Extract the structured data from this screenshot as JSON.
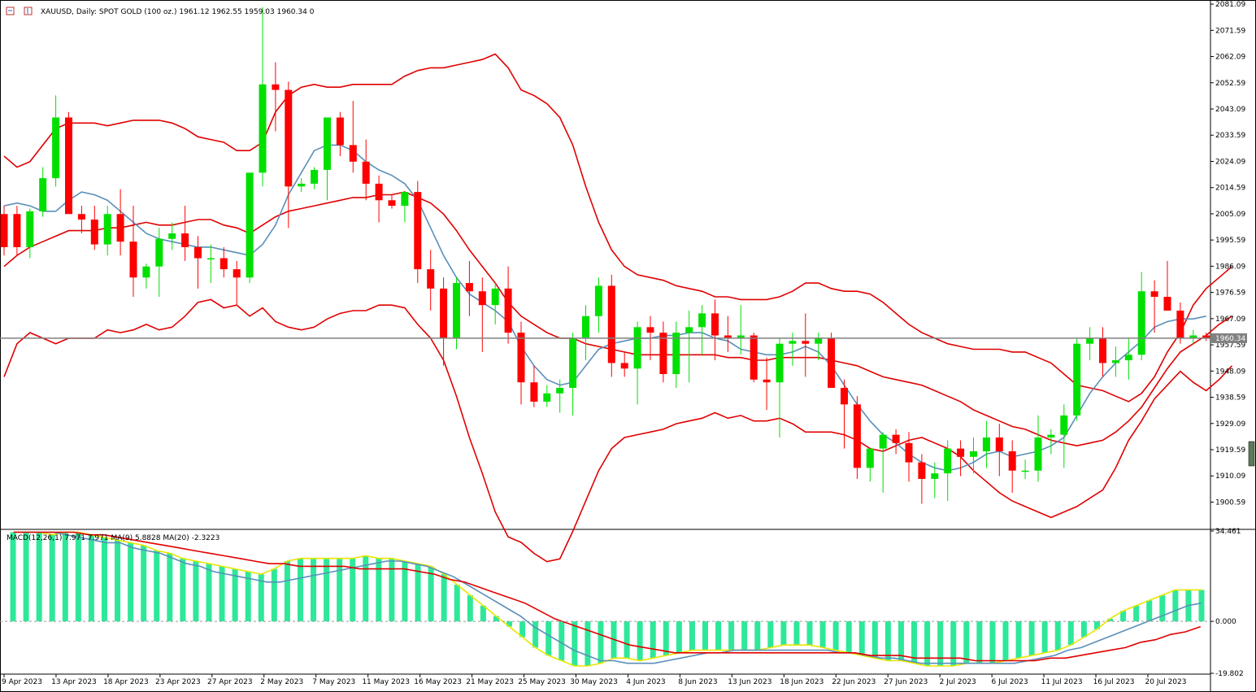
{
  "header": {
    "symbol": "XAUUSD",
    "timeframe": "Daily",
    "description": "SPOT GOLD (100 oz.)",
    "ohlc": "1961.12 1962.55 1959.03 1960.34",
    "volume": "0"
  },
  "indicator_header": "MACD(12,26,1) 7.971 7.971 MA(9) 5.8828 MA(20) -2.3223",
  "current_price_label": "1960.34",
  "colors": {
    "bull": "#00e000",
    "bear": "#ff0000",
    "bollinger": "#e00000",
    "sma": "#5a8fba",
    "macd_hist": "#2ee89a",
    "macd_line": "#e6e600",
    "macd_ma9": "#5a8fba",
    "macd_ma20": "#e00000"
  },
  "chart_data": [
    {
      "type": "candlestick",
      "title": "XAUUSD, Daily: SPOT GOLD (100 oz.)",
      "ylim": [
        1891.0,
        2082.0
      ],
      "y_ticks": [
        "2081.09",
        "2071.59",
        "2062.09",
        "2052.59",
        "2043.09",
        "2033.59",
        "2024.09",
        "2014.59",
        "2005.09",
        "1995.59",
        "1986.09",
        "1976.59",
        "1967.09",
        "1957.59",
        "1948.09",
        "1938.59",
        "1929.09",
        "1919.59",
        "1910.09",
        "1900.59"
      ],
      "x_tick_labels": [
        "9 Apr 2023",
        "13 Apr 2023",
        "18 Apr 2023",
        "23 Apr 2023",
        "27 Apr 2023",
        "2 May 2023",
        "7 May 2023",
        "11 May 2023",
        "16 May 2023",
        "21 May 2023",
        "25 May 2023",
        "30 May 2023",
        "4 Jun 2023",
        "8 Jun 2023",
        "13 Jun 2023",
        "18 Jun 2023",
        "22 Jun 2023",
        "27 Jun 2023",
        "2 Jul 2023",
        "6 Jul 2023",
        "11 Jul 2023",
        "16 Jul 2023",
        "20 Jul 2023"
      ],
      "candles": [
        [
          2005,
          2008,
          1990,
          1993
        ],
        [
          2005,
          2008,
          1990,
          1993
        ],
        [
          1993,
          2007,
          1989,
          2006
        ],
        [
          2006,
          2022,
          2004,
          2018
        ],
        [
          2018,
          2048,
          2015,
          2040
        ],
        [
          2040,
          2042,
          2016,
          2005
        ],
        [
          2005,
          2008,
          1998,
          2003
        ],
        [
          2003,
          2008,
          1992,
          1994
        ],
        [
          1994,
          2008,
          1990,
          2005
        ],
        [
          2005,
          2014,
          1990,
          1995
        ],
        [
          1995,
          2008,
          1975,
          1982
        ],
        [
          1982,
          1987,
          1978,
          1986
        ],
        [
          1986,
          2000,
          1975,
          1996
        ],
        [
          1996,
          2002,
          1992,
          1998
        ],
        [
          1998,
          2008,
          1988,
          1993
        ],
        [
          1993,
          1997,
          1978,
          1989
        ],
        [
          1989,
          1994,
          1980,
          1989
        ],
        [
          1989,
          1993,
          1982,
          1985
        ],
        [
          1985,
          1988,
          1972,
          1982
        ],
        [
          1982,
          2014,
          1980,
          2020
        ],
        [
          2020,
          2080,
          2015,
          2052
        ],
        [
          2052,
          2060,
          2035,
          2050
        ],
        [
          2050,
          2053,
          2000,
          2015
        ],
        [
          2015,
          2018,
          2013,
          2016
        ],
        [
          2016,
          2022,
          2014,
          2021
        ],
        [
          2021,
          2040,
          2010,
          2040
        ],
        [
          2040,
          2042,
          2026,
          2030
        ],
        [
          2030,
          2046,
          2020,
          2024
        ],
        [
          2024,
          2032,
          2010,
          2016
        ],
        [
          2016,
          2019,
          2002,
          2010
        ],
        [
          2010,
          2012,
          2007,
          2008
        ],
        [
          2008,
          2012,
          2002,
          2013
        ],
        [
          2013,
          2017,
          1980,
          1985
        ],
        [
          1985,
          1992,
          1970,
          1978
        ],
        [
          1978,
          1982,
          1950,
          1960
        ],
        [
          1960,
          1982,
          1956,
          1980
        ],
        [
          1980,
          1988,
          1968,
          1977
        ],
        [
          1977,
          1982,
          1955,
          1972
        ],
        [
          1972,
          1980,
          1965,
          1978
        ],
        [
          1978,
          1986,
          1958,
          1962
        ],
        [
          1962,
          1966,
          1936,
          1944
        ],
        [
          1944,
          1950,
          1935,
          1937
        ],
        [
          1937,
          1943,
          1935,
          1940
        ],
        [
          1940,
          1945,
          1933,
          1942
        ],
        [
          1942,
          1962,
          1932,
          1960
        ],
        [
          1960,
          1972,
          1952,
          1968
        ],
        [
          1968,
          1982,
          1962,
          1979
        ],
        [
          1979,
          1983,
          1946,
          1951
        ],
        [
          1951,
          1955,
          1946,
          1949
        ],
        [
          1949,
          1966,
          1936,
          1964
        ],
        [
          1964,
          1968,
          1952,
          1962
        ],
        [
          1962,
          1966,
          1944,
          1947
        ],
        [
          1947,
          1966,
          1942,
          1962
        ],
        [
          1962,
          1970,
          1944,
          1964
        ],
        [
          1964,
          1972,
          1954,
          1969
        ],
        [
          1969,
          1974,
          1952,
          1961
        ],
        [
          1961,
          1968,
          1955,
          1960
        ],
        [
          1960,
          1972,
          1954,
          1961
        ],
        [
          1961,
          1962,
          1944,
          1945
        ],
        [
          1945,
          1953,
          1934,
          1944
        ],
        [
          1944,
          1960,
          1924,
          1958
        ],
        [
          1958,
          1962,
          1950,
          1959
        ],
        [
          1959,
          1969,
          1946,
          1958
        ],
        [
          1958,
          1962,
          1952,
          1960
        ],
        [
          1960,
          1962,
          1942,
          1942
        ],
        [
          1942,
          1945,
          1920,
          1936
        ],
        [
          1936,
          1939,
          1909,
          1913
        ],
        [
          1913,
          1920,
          1908,
          1920
        ],
        [
          1920,
          1926,
          1904,
          1925
        ],
        [
          1925,
          1927,
          1918,
          1922
        ],
        [
          1922,
          1926,
          1908,
          1915
        ],
        [
          1915,
          1918,
          1900,
          1909
        ],
        [
          1909,
          1915,
          1902,
          1911
        ],
        [
          1911,
          1923,
          1901,
          1920
        ],
        [
          1920,
          1923,
          1910,
          1917
        ],
        [
          1917,
          1924,
          1911,
          1919
        ],
        [
          1919,
          1930,
          1913,
          1924
        ],
        [
          1924,
          1929,
          1910,
          1919
        ],
        [
          1919,
          1923,
          1904,
          1912
        ],
        [
          1912,
          1916,
          1909,
          1912
        ],
        [
          1912,
          1932,
          1908,
          1924
        ],
        [
          1924,
          1927,
          1918,
          1925
        ],
        [
          1925,
          1936,
          1913,
          1932
        ],
        [
          1932,
          1960,
          1930,
          1958
        ],
        [
          1958,
          1964,
          1952,
          1960
        ],
        [
          1960,
          1964,
          1946,
          1951
        ],
        [
          1951,
          1957,
          1946,
          1952
        ],
        [
          1952,
          1960,
          1945,
          1954
        ],
        [
          1954,
          1984,
          1952,
          1977
        ],
        [
          1977,
          1981,
          1962,
          1975
        ],
        [
          1975,
          1988,
          1970,
          1970
        ],
        [
          1970,
          1973,
          1958,
          1960
        ],
        [
          1960,
          1963,
          1958,
          1961
        ],
        [
          1961,
          1962,
          1959,
          1960
        ]
      ],
      "sma": [
        2008,
        2009,
        2008,
        2006,
        2006,
        2010,
        2013,
        2012,
        2010,
        2006,
        2002,
        1998,
        1996,
        1995,
        1994,
        1993,
        1993,
        1992,
        1991,
        1990,
        1994,
        2001,
        2012,
        2020,
        2028,
        2030,
        2030,
        2028,
        2024,
        2021,
        2019,
        2016,
        2010,
        2000,
        1990,
        1982,
        1976,
        1973,
        1970,
        1966,
        1957,
        1950,
        1945,
        1943,
        1944,
        1950,
        1956,
        1958,
        1959,
        1960,
        1960,
        1961,
        1961,
        1962,
        1962,
        1960,
        1959,
        1956,
        1955,
        1954,
        1954,
        1955,
        1957,
        1955,
        1950,
        1943,
        1936,
        1930,
        1925,
        1922,
        1918,
        1915,
        1913,
        1912,
        1913,
        1915,
        1918,
        1919,
        1917,
        1918,
        1919,
        1921,
        1924,
        1932,
        1940,
        1946,
        1951,
        1955,
        1959,
        1964,
        1966,
        1967,
        1967,
        1968
      ],
      "bollinger_upper": [
        2026,
        2022,
        2024,
        2030,
        2036,
        2038,
        2038,
        2038,
        2037,
        2038,
        2039,
        2039,
        2039,
        2038,
        2036,
        2033,
        2032,
        2031,
        2028,
        2028,
        2031,
        2042,
        2048,
        2051,
        2052,
        2051,
        2051,
        2052,
        2052,
        2052,
        2052,
        2055,
        2057,
        2058,
        2058,
        2059,
        2060,
        2061,
        2063,
        2058,
        2050,
        2048,
        2045,
        2040,
        2030,
        2015,
        2002,
        1992,
        1986,
        1983,
        1982,
        1981,
        1979,
        1978,
        1977,
        1975,
        1975,
        1974,
        1974,
        1974,
        1975,
        1977,
        1980,
        1980,
        1978,
        1977,
        1977,
        1976,
        1973,
        1969,
        1965,
        1962,
        1960,
        1958,
        1957,
        1956,
        1956,
        1956,
        1955,
        1955,
        1953,
        1951,
        1947,
        1943,
        1942,
        1941,
        1939,
        1937,
        1940,
        1946,
        1955,
        1962,
        1972,
        1978,
        1982,
        1986
      ],
      "bollinger_mid": [
        1986,
        1990,
        1993,
        1995,
        1997,
        1999,
        1999,
        1999,
        2000,
        2000,
        2001,
        2002,
        2001,
        2001,
        2002,
        2003,
        2003,
        2001,
        2000,
        1998,
        2001,
        2004,
        2006,
        2007,
        2008,
        2009,
        2010,
        2011,
        2011,
        2012,
        2012,
        2013,
        2011,
        2009,
        2005,
        1999,
        1992,
        1986,
        1980,
        1973,
        1968,
        1965,
        1962,
        1960,
        1960,
        1958,
        1957,
        1956,
        1955,
        1954,
        1954,
        1954,
        1954,
        1954,
        1954,
        1954,
        1953,
        1953,
        1952,
        1952,
        1953,
        1953,
        1953,
        1953,
        1952,
        1951,
        1950,
        1948,
        1946,
        1945,
        1944,
        1943,
        1941,
        1939,
        1937,
        1934,
        1932,
        1930,
        1928,
        1927,
        1925,
        1923,
        1922,
        1921,
        1922,
        1923,
        1926,
        1930,
        1935,
        1942,
        1949,
        1955,
        1958,
        1961,
        1965,
        1968
      ],
      "bollinger_lower": [
        1946,
        1958,
        1962,
        1960,
        1958,
        1960,
        1960,
        1960,
        1963,
        1962,
        1963,
        1965,
        1963,
        1964,
        1968,
        1973,
        1974,
        1971,
        1972,
        1968,
        1971,
        1966,
        1964,
        1963,
        1964,
        1967,
        1969,
        1970,
        1970,
        1972,
        1972,
        1971,
        1965,
        1960,
        1952,
        1939,
        1924,
        1911,
        1897,
        1888,
        1886,
        1882,
        1879,
        1880,
        1890,
        1901,
        1912,
        1920,
        1924,
        1925,
        1926,
        1927,
        1929,
        1930,
        1931,
        1933,
        1931,
        1932,
        1930,
        1930,
        1931,
        1929,
        1926,
        1926,
        1926,
        1925,
        1923,
        1920,
        1919,
        1921,
        1923,
        1924,
        1922,
        1920,
        1917,
        1912,
        1908,
        1904,
        1901,
        1899,
        1897,
        1895,
        1897,
        1899,
        1902,
        1905,
        1913,
        1923,
        1930,
        1938,
        1943,
        1948,
        1944,
        1941,
        1945,
        1950
      ]
    },
    {
      "type": "bar",
      "title": "MACD(12,26,1) 7.971 7.971 MA(9) 5.8828 MA(20) -2.3223",
      "ylim": [
        -19.802,
        34.461
      ],
      "y_ticks": [
        "34.461",
        "0.000",
        "-19.802"
      ],
      "series": [
        {
          "name": "MACD(12,26,1)",
          "values": [
            34,
            34,
            34,
            33,
            34,
            34,
            33,
            32,
            31,
            30,
            29,
            27,
            26,
            24,
            23,
            22,
            21,
            20,
            19,
            18,
            20,
            23,
            24,
            24,
            24,
            24,
            24,
            25,
            24,
            24,
            23,
            22,
            21,
            18,
            14,
            10,
            6,
            2,
            -2,
            -6,
            -10,
            -13,
            -15,
            -17,
            -17,
            -16,
            -14,
            -14,
            -15,
            -14,
            -13,
            -12,
            -11,
            -11,
            -11,
            -11,
            -11,
            -11,
            -10,
            -9,
            -9,
            -9,
            -10,
            -11,
            -12,
            -13,
            -14,
            -15,
            -15,
            -16,
            -17,
            -17,
            -17,
            -16,
            -16,
            -16,
            -15,
            -14,
            -13,
            -12,
            -11,
            -9,
            -6,
            -3,
            1,
            4,
            6,
            8,
            10,
            12,
            12,
            12
          ]
        },
        {
          "name": "MA(9)",
          "values": [
            34,
            34,
            34,
            34,
            33,
            32,
            31,
            30,
            30,
            28,
            27,
            26,
            24,
            22,
            21,
            19,
            18,
            17,
            16,
            15,
            15,
            16,
            17,
            18,
            19,
            20,
            21,
            22,
            23,
            23,
            22,
            21,
            19,
            17,
            14,
            11,
            8,
            5,
            2,
            -2,
            -5,
            -8,
            -11,
            -13,
            -15,
            -15,
            -16,
            -16,
            -16,
            -15,
            -14,
            -13,
            -12,
            -12,
            -11,
            -11,
            -11,
            -11,
            -11,
            -11,
            -11,
            -11,
            -12,
            -12,
            -13,
            -14,
            -14,
            -15,
            -16,
            -16,
            -16,
            -16,
            -16,
            -16,
            -16,
            -16,
            -15,
            -14,
            -13,
            -11,
            -10,
            -8,
            -6,
            -4,
            -2,
            0,
            2,
            4,
            6,
            7
          ]
        },
        {
          "name": "MA(20)",
          "values": [
            34,
            34,
            34,
            34,
            34,
            33,
            33,
            32,
            31,
            30,
            29,
            28,
            27,
            26,
            25,
            24,
            23,
            22,
            22,
            21,
            21,
            21,
            21,
            20,
            20,
            20,
            20,
            19,
            18,
            16,
            15,
            13,
            11,
            9,
            7,
            4,
            1,
            -1,
            -3,
            -5,
            -7,
            -9,
            -10,
            -11,
            -12,
            -12,
            -12,
            -12,
            -12,
            -12,
            -12,
            -12,
            -12,
            -12,
            -12,
            -12,
            -12,
            -13,
            -13,
            -13,
            -14,
            -14,
            -14,
            -14,
            -15,
            -15,
            -15,
            -15,
            -15,
            -14,
            -14,
            -13,
            -12,
            -11,
            -10,
            -8,
            -7,
            -5,
            -4,
            -2
          ]
        }
      ]
    }
  ]
}
